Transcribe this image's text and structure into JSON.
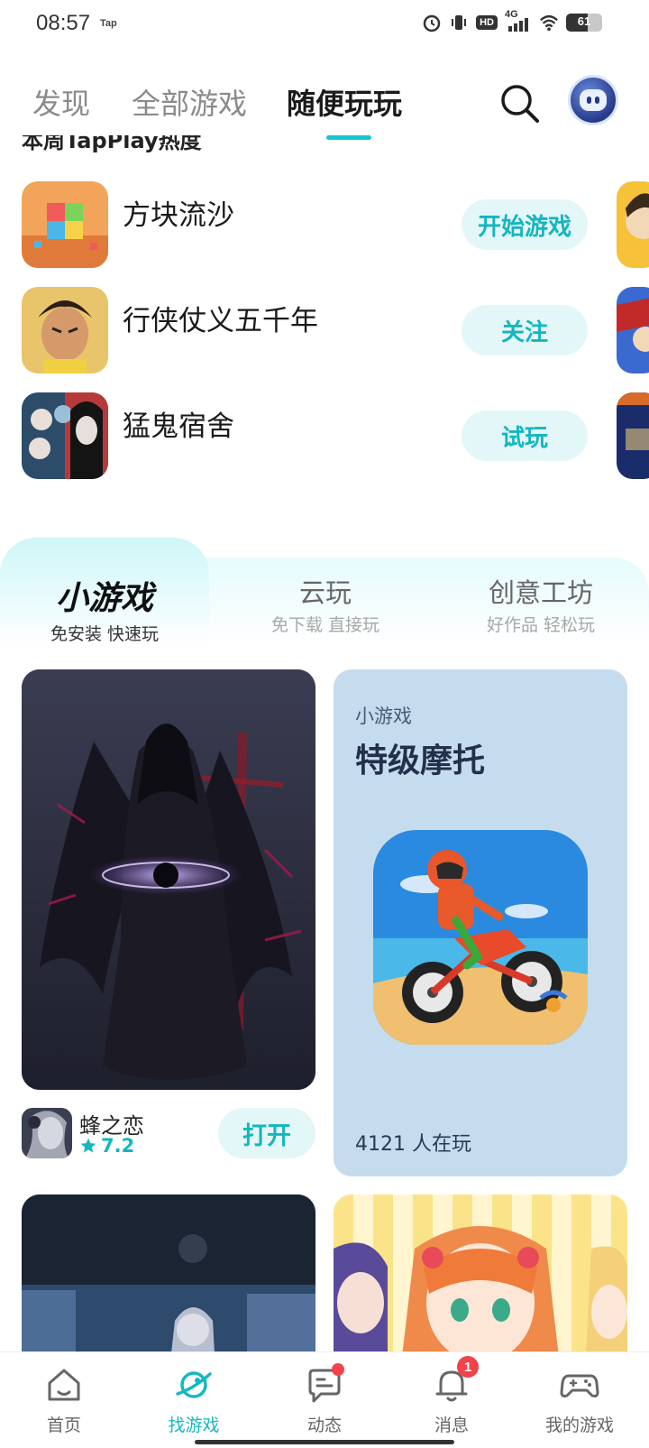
{
  "status_bar": {
    "time": "08:57",
    "carrier_tag": "Tap",
    "hd": "HD",
    "network": "4G",
    "battery": "61",
    "battery_level": 0.61
  },
  "top_nav": {
    "tabs": [
      {
        "label": "发现"
      },
      {
        "label": "全部游戏"
      },
      {
        "label": "随便玩玩"
      }
    ],
    "active_tab": "随便玩玩"
  },
  "section_header_cut": "本周TapPlay热度",
  "games": [
    {
      "name": "方块流沙",
      "action": "开始游戏"
    },
    {
      "name": "行侠仗义五千年",
      "action": "关注"
    },
    {
      "name": "猛鬼宿舍",
      "action": "试玩"
    }
  ],
  "categories": [
    {
      "title": "小游戏",
      "subtitle": "免安装 快速玩"
    },
    {
      "title": "云玩",
      "subtitle": "免下载 直接玩"
    },
    {
      "title": "创意工坊",
      "subtitle": "好作品 轻松玩"
    }
  ],
  "featured_game": {
    "name": "蜂之恋",
    "rating": "7.2",
    "rating_value": 7.2,
    "action": "打开"
  },
  "mini_game_card": {
    "tag": "小游戏",
    "title": "特级摩托",
    "players": "4121 人在玩"
  },
  "bottom_nav": {
    "items": [
      {
        "label": "首页",
        "icon": "home-icon"
      },
      {
        "label": "找游戏",
        "icon": "planet-icon"
      },
      {
        "label": "动态",
        "icon": "chat-icon"
      },
      {
        "label": "消息",
        "icon": "bell-icon",
        "badge": "1"
      },
      {
        "label": "我的游戏",
        "icon": "gamepad-icon"
      }
    ],
    "active": "找游戏"
  },
  "colors": {
    "accent": "#15c5ce",
    "button_bg": "#e4f7f8",
    "button_text": "#14b6c0",
    "badge": "#f2424a",
    "mini_card_bg": "#c5dcee"
  }
}
